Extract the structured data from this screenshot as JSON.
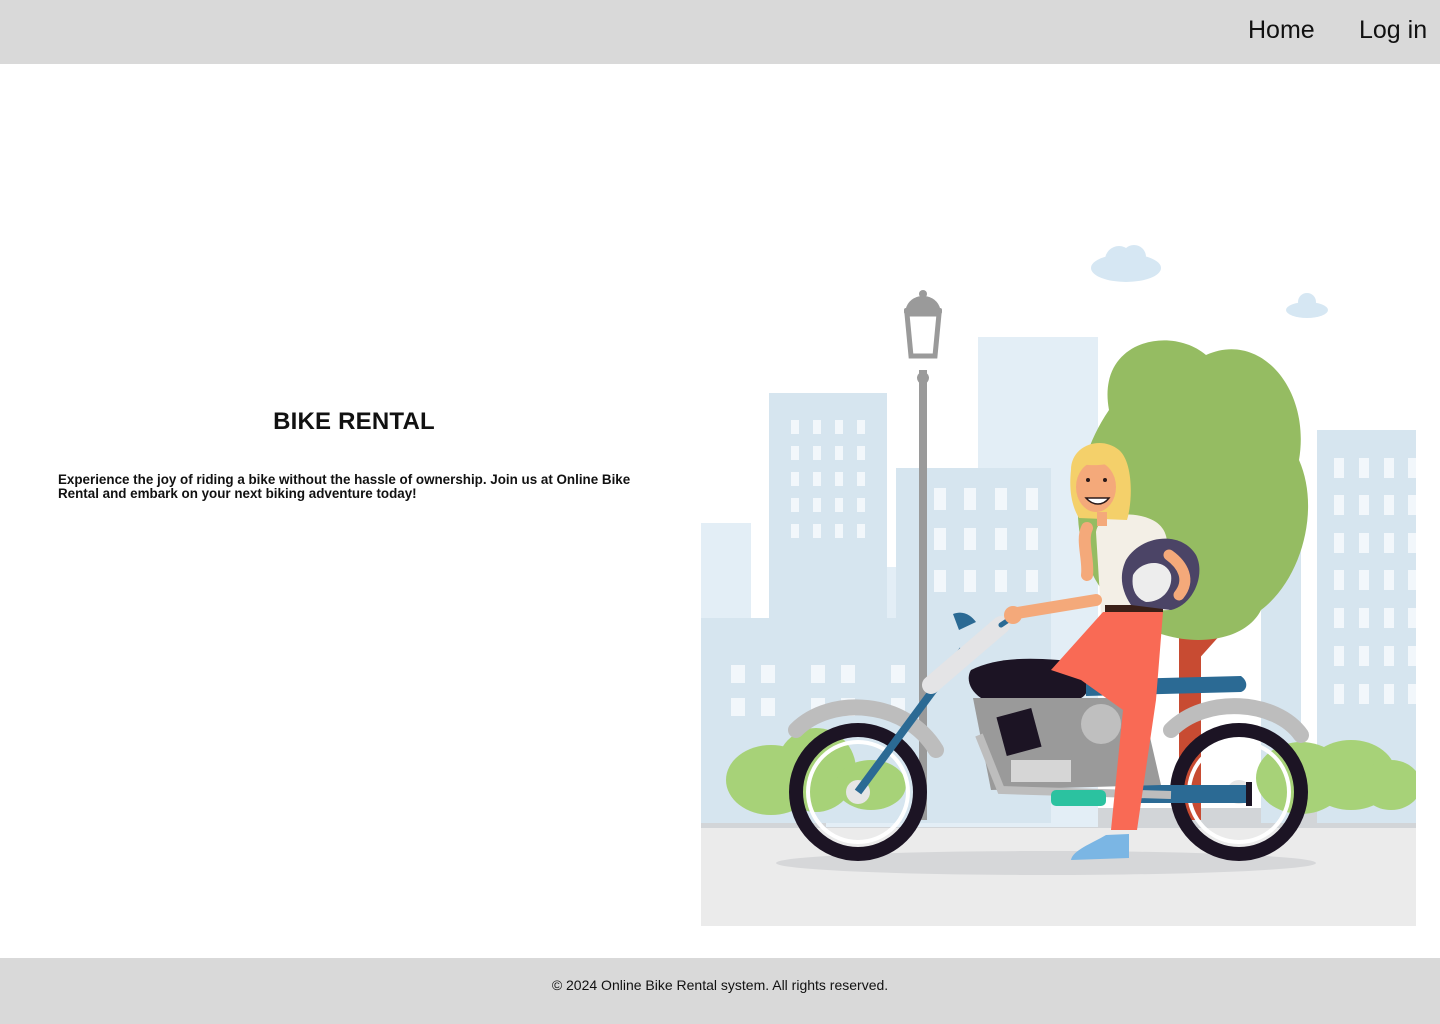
{
  "nav": {
    "home_label": "Home",
    "login_label": "Log in"
  },
  "hero": {
    "title": "BIKE RENTAL",
    "description": "Experience the joy of riding a bike without the hassle of ownership.  Join us at Online Bike Rental and embark on your next biking adventure  today!",
    "illustration_icon": "woman-with-motorcycle-illustration"
  },
  "footer": {
    "copyright": "© 2024 Online Bike Rental system. All rights reserved."
  },
  "colors": {
    "header_bg": "#d9d9d9",
    "footer_bg": "#d9d9d9",
    "page_bg": "#ffffff"
  }
}
